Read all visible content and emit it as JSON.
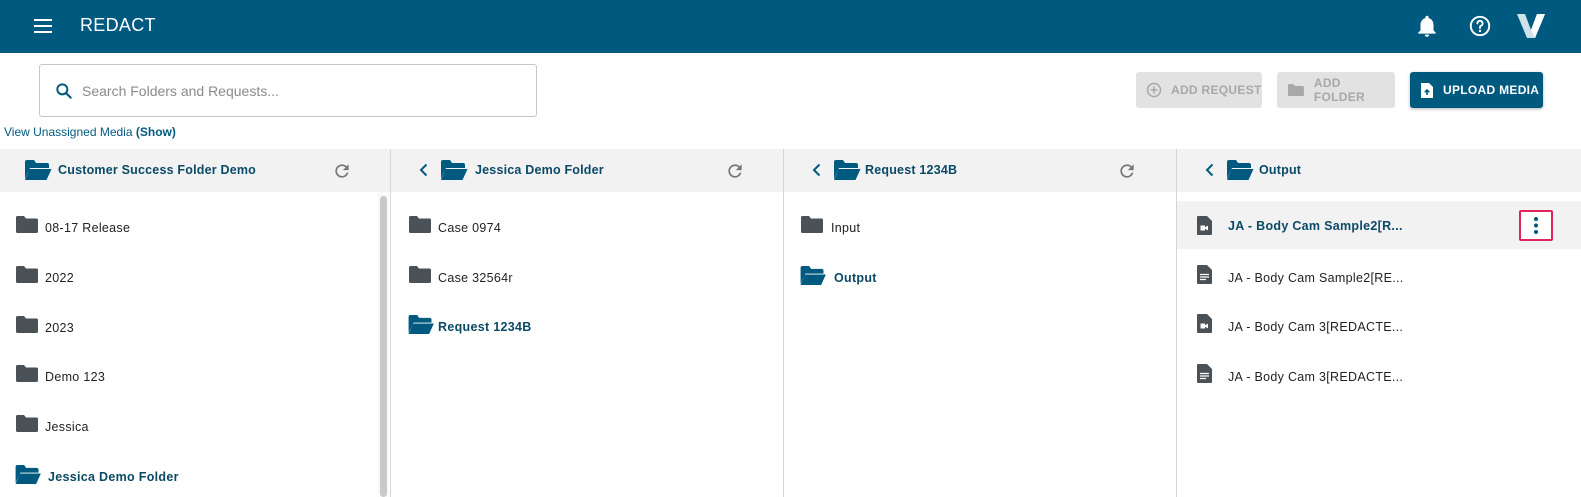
{
  "app": {
    "title": "REDACT"
  },
  "search": {
    "placeholder": "Search Folders and Requests..."
  },
  "actions": {
    "add_request": "ADD REQUEST",
    "add_folder": "ADD FOLDER",
    "upload_media": "UPLOAD MEDIA"
  },
  "unassigned": {
    "text": "View Unassigned Media ",
    "link": "(Show)"
  },
  "columns": [
    {
      "title": "Customer Success Folder Demo",
      "items": [
        {
          "label": "08-17 Release",
          "type": "folder"
        },
        {
          "label": "2022",
          "type": "folder"
        },
        {
          "label": "2023",
          "type": "folder"
        },
        {
          "label": "Demo 123",
          "type": "folder"
        },
        {
          "label": "Jessica",
          "type": "folder"
        },
        {
          "label": "Jessica Demo Folder",
          "type": "folder-open",
          "active": true
        }
      ]
    },
    {
      "title": "Jessica Demo Folder",
      "items": [
        {
          "label": "Case 0974",
          "type": "folder"
        },
        {
          "label": "Case 32564r",
          "type": "folder"
        },
        {
          "label": "Request 1234B",
          "type": "folder-open",
          "active": true
        }
      ]
    },
    {
      "title": "Request 1234B",
      "items": [
        {
          "label": "Input",
          "type": "folder"
        },
        {
          "label": "Output",
          "type": "folder-open",
          "active": true
        }
      ]
    },
    {
      "title": "Output",
      "items": [
        {
          "label": "JA - Body Cam Sample2[R...",
          "type": "video-file",
          "active": true,
          "selected": true
        },
        {
          "label": "JA - Body Cam Sample2[RE...",
          "type": "doc-file"
        },
        {
          "label": "JA - Body Cam 3[REDACTE...",
          "type": "video-file"
        },
        {
          "label": "JA - Body Cam 3[REDACTE...",
          "type": "doc-file"
        }
      ]
    }
  ],
  "colors": {
    "brand": "#005a7f",
    "header_text": "#0a4a66",
    "folder_dark": "#4a5258",
    "highlight_border": "#e0245e"
  }
}
